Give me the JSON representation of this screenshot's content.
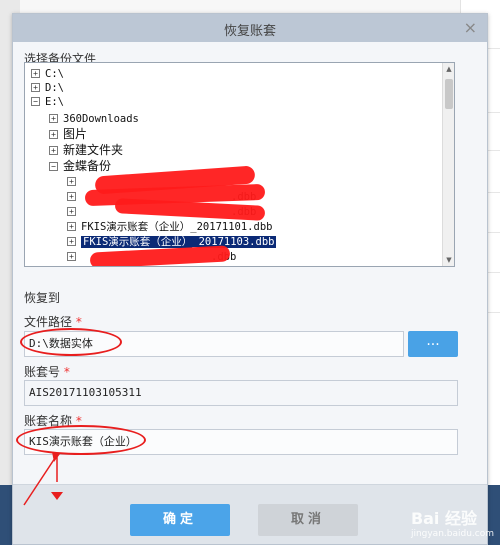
{
  "dialog": {
    "title": "恢复账套",
    "close_glyph": "×"
  },
  "backup_section": {
    "label": "选择备份文件"
  },
  "tree": {
    "expand_plus": "+",
    "expand_minus": "−",
    "items": [
      {
        "label": "C:\\",
        "state": "+"
      },
      {
        "label": "D:\\",
        "state": "+"
      },
      {
        "label": "E:\\",
        "state": "−"
      },
      {
        "label": "360Downloads",
        "state": "+"
      },
      {
        "label": "图片",
        "state": "+"
      },
      {
        "label": "新建文件夹",
        "state": "+"
      },
      {
        "label": "金蝶备份",
        "state": "−"
      },
      {
        "label": "FKIS演示账套（企业）_20171101.dbb",
        "state": "+"
      },
      {
        "label": "FKIS演示账套（企业）_20171103.dbb",
        "state": "+",
        "selected": true
      }
    ],
    "redacted_suffix": ".dbb"
  },
  "restore_section": {
    "label": "恢复到",
    "path_label": "文件路径",
    "path_value": "D:\\数据实体",
    "browse_label": "...",
    "account_no_label": "账套号",
    "account_no_value": "AIS20171103105311",
    "account_name_label": "账套名称",
    "account_name_value": "KIS演示账套（企业）",
    "required_mark": "*"
  },
  "buttons": {
    "ok": "确定",
    "cancel": "取消"
  },
  "background_column": {
    "cells": [
      "文",
      "A",
      "A",
      "IS",
      "A",
      "A",
      "A",
      "A"
    ]
  },
  "watermark": {
    "brand": "Bai 经验",
    "sub": "jingyan.baidu.com"
  },
  "colors": {
    "selection": "#0b2a76",
    "primary_button": "#4ba4e9",
    "annotation_red": "#e81e1e",
    "titlebar": "#bcc7d5"
  }
}
